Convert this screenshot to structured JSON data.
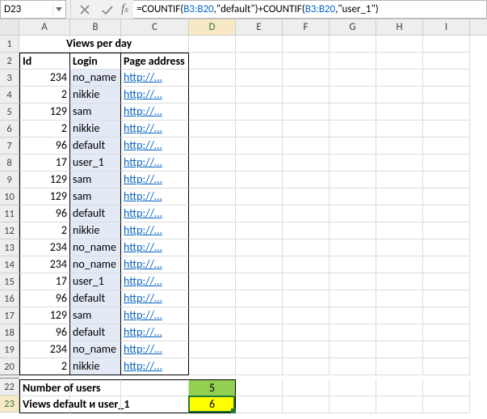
{
  "namebox": "D23",
  "formula": {
    "prefix": "=COUNTIF(",
    "ref1": "B3:B20",
    "mid1": ",\"default\")+COUNTIF(",
    "ref2": "B3:B20",
    "suffix": ",\"user_1\")"
  },
  "columns": [
    "A",
    "B",
    "C",
    "D",
    "E",
    "F",
    "G",
    "H",
    "I"
  ],
  "selected_col": "D",
  "row_start": 1,
  "row_end": 23,
  "hidden_rows": [
    21
  ],
  "selected_row": 23,
  "title": "Views per day",
  "headers": {
    "id": "Id",
    "login": "Login",
    "page": "Page address"
  },
  "rows": [
    {
      "id": 234,
      "login": "no_name",
      "page": "http://…"
    },
    {
      "id": 2,
      "login": "nikkie",
      "page": "http://…"
    },
    {
      "id": 129,
      "login": "sam",
      "page": "http://…"
    },
    {
      "id": 2,
      "login": "nikkie",
      "page": "http://…"
    },
    {
      "id": 96,
      "login": "default",
      "page": "http://…"
    },
    {
      "id": 17,
      "login": "user_1",
      "page": "http://…"
    },
    {
      "id": 129,
      "login": "sam",
      "page": "http://…"
    },
    {
      "id": 129,
      "login": "sam",
      "page": "http://…"
    },
    {
      "id": 96,
      "login": "default",
      "page": "http://…"
    },
    {
      "id": 2,
      "login": "nikkie",
      "page": "http://…"
    },
    {
      "id": 234,
      "login": "no_name",
      "page": "http://…"
    },
    {
      "id": 234,
      "login": "no_name",
      "page": "http://…"
    },
    {
      "id": 17,
      "login": "user_1",
      "page": "http://…"
    },
    {
      "id": 96,
      "login": "default",
      "page": "http://…"
    },
    {
      "id": 129,
      "login": "sam",
      "page": "http://…"
    },
    {
      "id": 96,
      "login": "default",
      "page": "http://…"
    },
    {
      "id": 234,
      "login": "no_name",
      "page": "http://…"
    },
    {
      "id": 2,
      "login": "nikkie",
      "page": "http://…"
    }
  ],
  "summary": {
    "users_label": "Number of users",
    "users_value": 5,
    "default_label": "Views default и user_1",
    "default_value": 6
  },
  "active_cell": {
    "col": "D",
    "row": 23
  }
}
